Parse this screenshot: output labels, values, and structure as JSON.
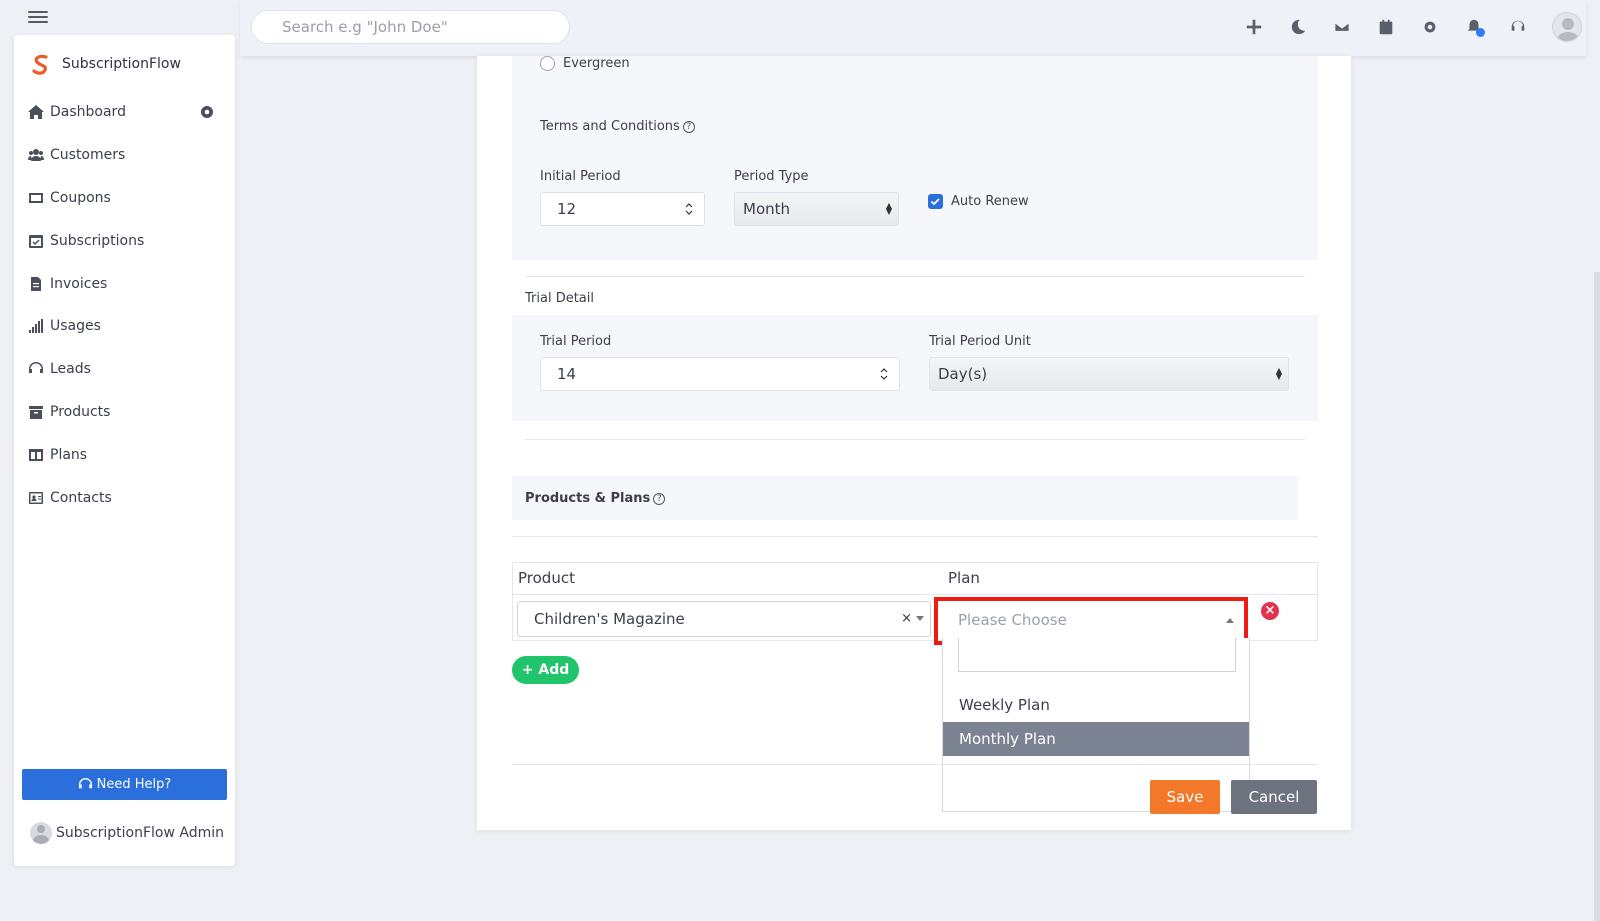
{
  "search": {
    "placeholder": "Search e.g \"John Doe\""
  },
  "sidebar": {
    "brand": "SubscriptionFlow",
    "items": [
      {
        "label": "Dashboard",
        "icon": "home-icon"
      },
      {
        "label": "Customers",
        "icon": "users-icon"
      },
      {
        "label": "Coupons",
        "icon": "ticket-icon"
      },
      {
        "label": "Subscriptions",
        "icon": "calendar-check-icon"
      },
      {
        "label": "Invoices",
        "icon": "invoice-icon"
      },
      {
        "label": "Usages",
        "icon": "signal-bars-icon"
      },
      {
        "label": "Leads",
        "icon": "headset-icon"
      },
      {
        "label": "Products",
        "icon": "archive-icon"
      },
      {
        "label": "Plans",
        "icon": "columns-icon"
      },
      {
        "label": "Contacts",
        "icon": "contact-card-icon"
      }
    ],
    "help_label": "Need Help?",
    "admin_name": "SubscriptionFlow Admin"
  },
  "form": {
    "evergreen_label": "Evergreen",
    "terms_label": "Terms and Conditions",
    "initial_period_label": "Initial Period",
    "initial_period_value": "12",
    "period_type_label": "Period Type",
    "period_type_value": "Month",
    "auto_renew_label": "Auto Renew",
    "trial_detail_label": "Trial Detail",
    "trial_period_label": "Trial Period",
    "trial_period_value": "14",
    "trial_unit_label": "Trial Period Unit",
    "trial_unit_value": "Day(s)",
    "products_plans_label": "Products & Plans",
    "product_header": "Product",
    "plan_header": "Plan",
    "product_value": "Children's Magazine",
    "plan_placeholder": "Please Choose",
    "plan_options": [
      "Weekly Plan",
      "Monthly Plan"
    ],
    "plan_highlighted": "Monthly Plan",
    "add_label": "+ Add",
    "save_label": "Save",
    "cancel_label": "Cancel"
  },
  "colors": {
    "primary": "#2a6fdb",
    "save": "#f4782a",
    "cancel": "#6c727e",
    "add": "#20c46a",
    "highlight_border": "#ee1c12",
    "remove": "#e03550"
  }
}
